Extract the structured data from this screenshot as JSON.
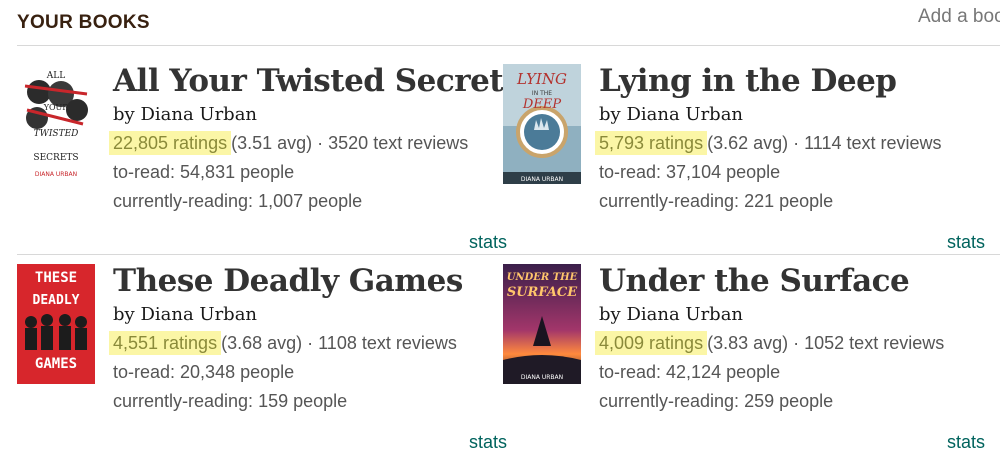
{
  "header": {
    "title": "YOUR BOOKS",
    "add_link": "Add a boo"
  },
  "books": [
    {
      "title": "All Your Twisted Secrets",
      "by": "by",
      "author": "Diana Urban",
      "ratings": "22,805 ratings",
      "avg": "(3.51 avg)",
      "reviews": "· 3520 text reviews",
      "to_read": "to-read: 54,831 people",
      "currently_reading": "currently-reading: 1,007 people",
      "stats_label": "stats",
      "cover": {
        "line1": "ALL",
        "line2": "YOUR",
        "line3": "TWISTED",
        "line4": "SECRETS",
        "author": "DIANA URBAN",
        "bg": "#ffffff",
        "accent": "#c8262b"
      }
    },
    {
      "title": "Lying in the Deep",
      "by": "by",
      "author": "Diana Urban",
      "ratings": "5,793 ratings",
      "avg": "(3.62 avg)",
      "reviews": "· 1114 text reviews",
      "to_read": "to-read: 37,104 people",
      "currently_reading": "currently-reading: 221 people",
      "stats_label": "stats",
      "cover": {
        "line1": "LYING",
        "line2": "IN THE",
        "line3": "DEEP",
        "author": "DIANA URBAN",
        "bg": "#bfd3dc",
        "accent": "#b3322e"
      }
    },
    {
      "title": "These Deadly Games",
      "by": "by",
      "author": "Diana Urban",
      "ratings": "4,551 ratings",
      "avg": "(3.68 avg)",
      "reviews": "· 1108 text reviews",
      "to_read": "to-read: 20,348 people",
      "currently_reading": "currently-reading: 159 people",
      "stats_label": "stats",
      "cover": {
        "line1": "THESE",
        "line2": "DEADLY",
        "line3": "GAMES",
        "bg": "#d7262c",
        "accent": "#ffffff"
      }
    },
    {
      "title": "Under the Surface",
      "by": "by",
      "author": "Diana Urban",
      "ratings": "4,009 ratings",
      "avg": "(3.83 avg)",
      "reviews": "· 1052 text reviews",
      "to_read": "to-read: 42,124 people",
      "currently_reading": "currently-reading: 259 people",
      "stats_label": "stats",
      "cover": {
        "line1": "UNDER THE",
        "line2": "SURFACE",
        "author": "DIANA URBAN",
        "bg": "#3a1f4a",
        "accent": "#ff8a3d"
      }
    }
  ]
}
